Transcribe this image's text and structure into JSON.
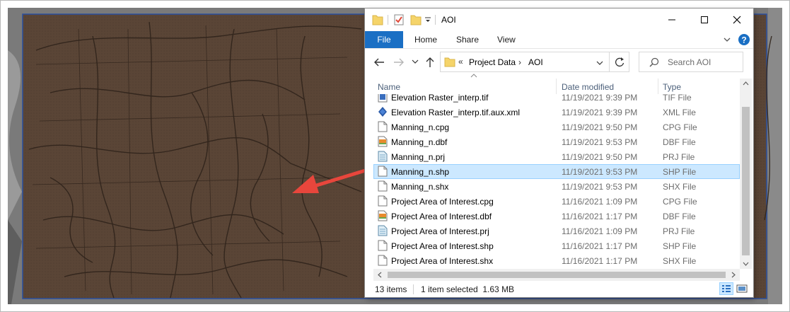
{
  "window": {
    "title": "AOI",
    "controls": {
      "minimize": "minimize-icon",
      "maximize": "maximize-icon",
      "close": "close-icon"
    }
  },
  "ribbon": {
    "tabs": [
      "File",
      "Home",
      "Share",
      "View"
    ]
  },
  "address": {
    "overflow": "«",
    "crumbs": [
      "Project Data",
      "AOI"
    ]
  },
  "search": {
    "placeholder": "Search AOI"
  },
  "columns": {
    "name": "Name",
    "date": "Date modified",
    "type": "Type"
  },
  "files": [
    {
      "name": "Elevation Raster_interp.tif",
      "date": "11/19/2021 9:39 PM",
      "type": "TIF File",
      "icon": "raster-file-icon"
    },
    {
      "name": "Elevation Raster_interp.tif.aux.xml",
      "date": "11/19/2021 9:39 PM",
      "type": "XML File",
      "icon": "xml-layer-icon"
    },
    {
      "name": "Manning_n.cpg",
      "date": "11/19/2021 9:50 PM",
      "type": "CPG File",
      "icon": "blank-file-icon"
    },
    {
      "name": "Manning_n.dbf",
      "date": "11/19/2021 9:53 PM",
      "type": "DBF File",
      "icon": "dbf-file-icon"
    },
    {
      "name": "Manning_n.prj",
      "date": "11/19/2021 9:50 PM",
      "type": "PRJ File",
      "icon": "prj-file-icon"
    },
    {
      "name": "Manning_n.shp",
      "date": "11/19/2021 9:53 PM",
      "type": "SHP File",
      "icon": "blank-file-icon",
      "selected": true
    },
    {
      "name": "Manning_n.shx",
      "date": "11/19/2021 9:53 PM",
      "type": "SHX File",
      "icon": "blank-file-icon"
    },
    {
      "name": "Project Area of Interest.cpg",
      "date": "11/16/2021 1:09 PM",
      "type": "CPG File",
      "icon": "blank-file-icon"
    },
    {
      "name": "Project Area of Interest.dbf",
      "date": "11/16/2021 1:17 PM",
      "type": "DBF File",
      "icon": "dbf-file-icon"
    },
    {
      "name": "Project Area of Interest.prj",
      "date": "11/16/2021 1:09 PM",
      "type": "PRJ File",
      "icon": "prj-file-icon"
    },
    {
      "name": "Project Area of Interest.shp",
      "date": "11/16/2021 1:17 PM",
      "type": "SHP File",
      "icon": "blank-file-icon"
    },
    {
      "name": "Project Area of Interest.shx",
      "date": "11/16/2021 1:17 PM",
      "type": "SHX File",
      "icon": "blank-file-icon"
    }
  ],
  "status": {
    "item_count": "13 items",
    "selection": "1 item selected  1.63 MB"
  },
  "colors": {
    "accent": "#1a6fc4",
    "selection": "#cce8ff",
    "arrow": "#e8463c",
    "map_overlay": "#5a4536",
    "aoi_border": "#2b4f9e"
  }
}
